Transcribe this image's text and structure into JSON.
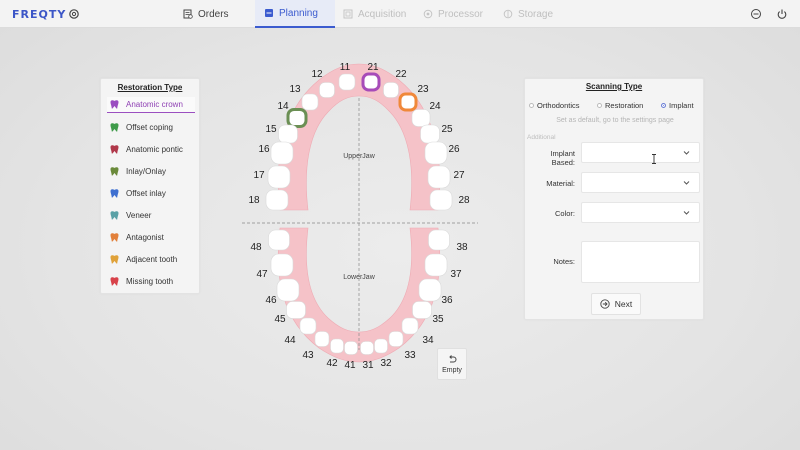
{
  "app": {
    "logo": "FREQTY"
  },
  "nav": {
    "orders": "Orders",
    "planning": "Planning",
    "acquisition": "Acquisition",
    "processor": "Processor",
    "storage": "Storage"
  },
  "restoration": {
    "title": "Restoration Type",
    "items": [
      {
        "label": "Anatomic crown",
        "icon": "crown-icon",
        "color": "#9a4cc0"
      },
      {
        "label": "Offset coping",
        "icon": "coping-icon",
        "color": "#3f9b4a"
      },
      {
        "label": "Anatomic pontic",
        "icon": "pontic-icon",
        "color": "#b0384a"
      },
      {
        "label": "Inlay/Onlay",
        "icon": "inlay-icon",
        "color": "#6a8a3a"
      },
      {
        "label": "Offset inlay",
        "icon": "offset-inlay-icon",
        "color": "#3e6fd0"
      },
      {
        "label": "Veneer",
        "icon": "veneer-icon",
        "color": "#5aa1a6"
      },
      {
        "label": "Antagonist",
        "icon": "antagonist-icon",
        "color": "#e2803a"
      },
      {
        "label": "Adjacent tooth",
        "icon": "adjacent-icon",
        "color": "#e0a23a"
      },
      {
        "label": "Missing tooth",
        "icon": "missing-icon",
        "color": "#d8424a"
      }
    ]
  },
  "scanning": {
    "title": "Scanning Type",
    "options": [
      "Orthodontics",
      "Restoration",
      "Implant"
    ],
    "selected": "Implant",
    "hint": "Set as default, go to the settings page",
    "additional": "Additional",
    "fields": {
      "implant_based": "Implant Based:",
      "material": "Material:",
      "color": "Color:",
      "notes": "Notes:"
    },
    "next": "Next"
  },
  "chart": {
    "upper_label": "UpperJaw",
    "lower_label": "LowerJaw",
    "upper_right": [
      "11",
      "12",
      "13",
      "14",
      "15",
      "16",
      "17",
      "18"
    ],
    "upper_left": [
      "21",
      "22",
      "23",
      "24",
      "25",
      "26",
      "27",
      "28"
    ],
    "lower_left": [
      "31",
      "32",
      "33",
      "34",
      "35",
      "36",
      "37",
      "38"
    ],
    "lower_right": [
      "41",
      "42",
      "43",
      "44",
      "45",
      "46",
      "47",
      "48"
    ],
    "marked": {
      "14": {
        "color": "#6b8f54"
      },
      "21": {
        "color": "#a74bb8"
      },
      "23": {
        "color": "#f0883a"
      }
    }
  },
  "empty": "Empty"
}
